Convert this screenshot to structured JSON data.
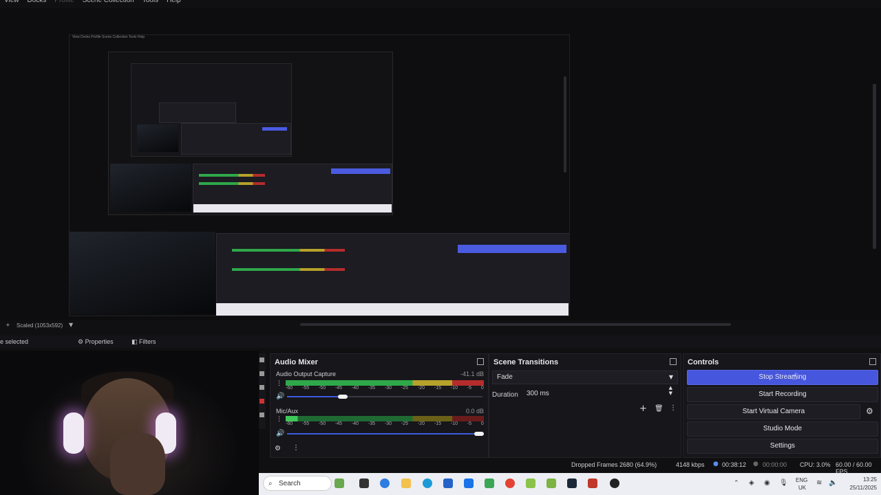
{
  "menu": {
    "items": [
      "View",
      "Docks",
      "Profile",
      "Scene Collection",
      "Tools",
      "Help"
    ],
    "disabled": [
      "Profile"
    ]
  },
  "preview": {
    "scaled_label": "Scaled (1053x592)",
    "nested_menu": "View  Docks  Profile  Scene Collection  Tools  Help"
  },
  "source_bar": {
    "selection_text": "e selected",
    "properties_label": "Properties",
    "filters_label": "Filters",
    "gear_icon": "gear-icon",
    "filter_icon": "filter-icon"
  },
  "audio_mixer": {
    "title": "Audio Mixer",
    "channels": [
      {
        "name": "Audio Output Capture",
        "level": "-41.1 dB",
        "volume_fraction": 0.28
      },
      {
        "name": "Mic/Aux",
        "level": "0.0 dB",
        "volume_fraction": 1.0
      }
    ],
    "ticks": [
      "-60",
      "-55",
      "-50",
      "-45",
      "-40",
      "-35",
      "-30",
      "-25",
      "-20",
      "-15",
      "-10",
      "-5",
      "0"
    ]
  },
  "scene_transitions": {
    "title": "Scene Transitions",
    "transition": "Fade",
    "duration_label": "Duration",
    "duration_value": "300 ms"
  },
  "controls": {
    "title": "Controls",
    "buttons": [
      "Stop Streaming",
      "Start Recording",
      "Start Virtual Camera",
      "Studio Mode",
      "Settings"
    ]
  },
  "status": {
    "dropped_frames": "Dropped Frames 2680 (64.9%)",
    "bitrate": "4148 kbps",
    "stream_time": "00:38:12",
    "record_time": "00:00:00",
    "cpu": "CPU: 3.0%",
    "fps": "60.00 / 60.00 FPS"
  },
  "taskbar": {
    "search_placeholder": "Search",
    "language": "ENG",
    "region": "UK",
    "time": "13:25",
    "date": "25/11/2025"
  },
  "colors": {
    "accent": "#4656dd",
    "meter_green": "#2fa84a",
    "meter_yellow": "#b6a22a",
    "meter_red": "#b52c2c"
  }
}
